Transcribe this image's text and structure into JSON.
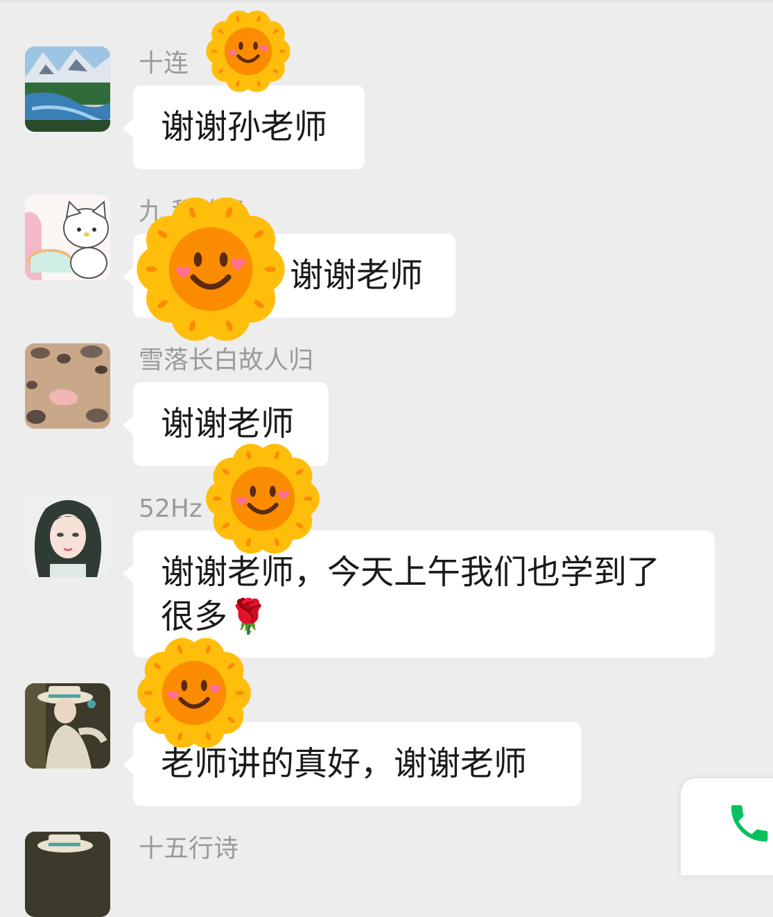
{
  "messages": [
    {
      "sender": "十连",
      "text": "谢谢孙老师",
      "avatar": "mountain-lake-avatar"
    },
    {
      "sender": "九 程乾稳",
      "text": "谢谢老师",
      "avatar": "cartoon-cat-avatar"
    },
    {
      "sender": "雪落长白故人归",
      "text": "谢谢老师",
      "avatar": "beach-stones-avatar"
    },
    {
      "sender": "52Hz",
      "text": "谢谢老师，今天上午我们也学到了很多🌹",
      "avatar": "anime-girl-avatar"
    },
    {
      "sender": "",
      "text": "老师讲的真好，谢谢老师",
      "avatar": "illustrated-character-avatar"
    },
    {
      "sender": "十五行诗",
      "text": "",
      "avatar": "illustrated-character-avatar"
    }
  ],
  "stickers": [
    "smiling-sun-sticker",
    "smiling-sun-sticker",
    "smiling-sun-sticker",
    "smiling-sun-sticker"
  ],
  "call_widget": {
    "icon": "phone-icon",
    "color": "#07c160"
  },
  "colors": {
    "background": "#ededed",
    "bubble": "#ffffff",
    "sender": "#9a9a9a",
    "sun_petal": "#ffbe0b",
    "sun_face": "#fb8c00"
  }
}
